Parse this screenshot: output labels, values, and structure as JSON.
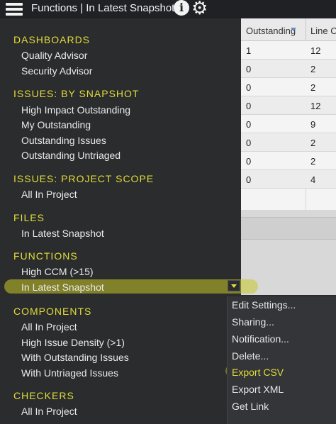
{
  "header": {
    "title": "Functions | In Latest Snapshot",
    "info_glyph": "i",
    "icons": [
      "hamburger-menu-icon",
      "info-icon",
      "gear-icon"
    ]
  },
  "table": {
    "columns": [
      "Outstanding",
      "Line C"
    ],
    "rows": [
      [
        "1",
        "12"
      ],
      [
        "0",
        "2"
      ],
      [
        "0",
        "2"
      ],
      [
        "0",
        "12"
      ],
      [
        "0",
        "9"
      ],
      [
        "0",
        "2"
      ],
      [
        "0",
        "2"
      ],
      [
        "0",
        "4"
      ]
    ]
  },
  "menu": {
    "dashboards": {
      "heading": "DASHBOARDS",
      "items": [
        "Quality Advisor",
        "Security Advisor"
      ]
    },
    "issues_snapshot": {
      "heading": "ISSUES: BY SNAPSHOT",
      "items": [
        "High Impact Outstanding",
        "My Outstanding",
        "Outstanding Issues",
        "Outstanding Untriaged"
      ]
    },
    "issues_project": {
      "heading": "ISSUES: PROJECT SCOPE",
      "items": [
        "All In Project"
      ]
    },
    "files": {
      "heading": "FILES",
      "items": [
        "In Latest Snapshot"
      ]
    },
    "functions": {
      "heading": "FUNCTIONS",
      "items": [
        "High CCM (>15)",
        "In Latest Snapshot"
      ]
    },
    "components": {
      "heading": "COMPONENTS",
      "items": [
        "All In Project",
        "High Issue Density (>1)",
        "With Outstanding Issues",
        "With Untriaged Issues"
      ]
    },
    "checkers": {
      "heading": "CHECKERS",
      "items": [
        "All In Project"
      ]
    }
  },
  "context_menu": {
    "items": [
      "Edit Settings...",
      "Sharing...",
      "Notification...",
      "Delete...",
      "Export CSV",
      "Export XML",
      "Get Link"
    ]
  },
  "colors": {
    "accent": "#e3dd3a",
    "background": "#2a2c2e",
    "topbar": "#1f2124"
  }
}
